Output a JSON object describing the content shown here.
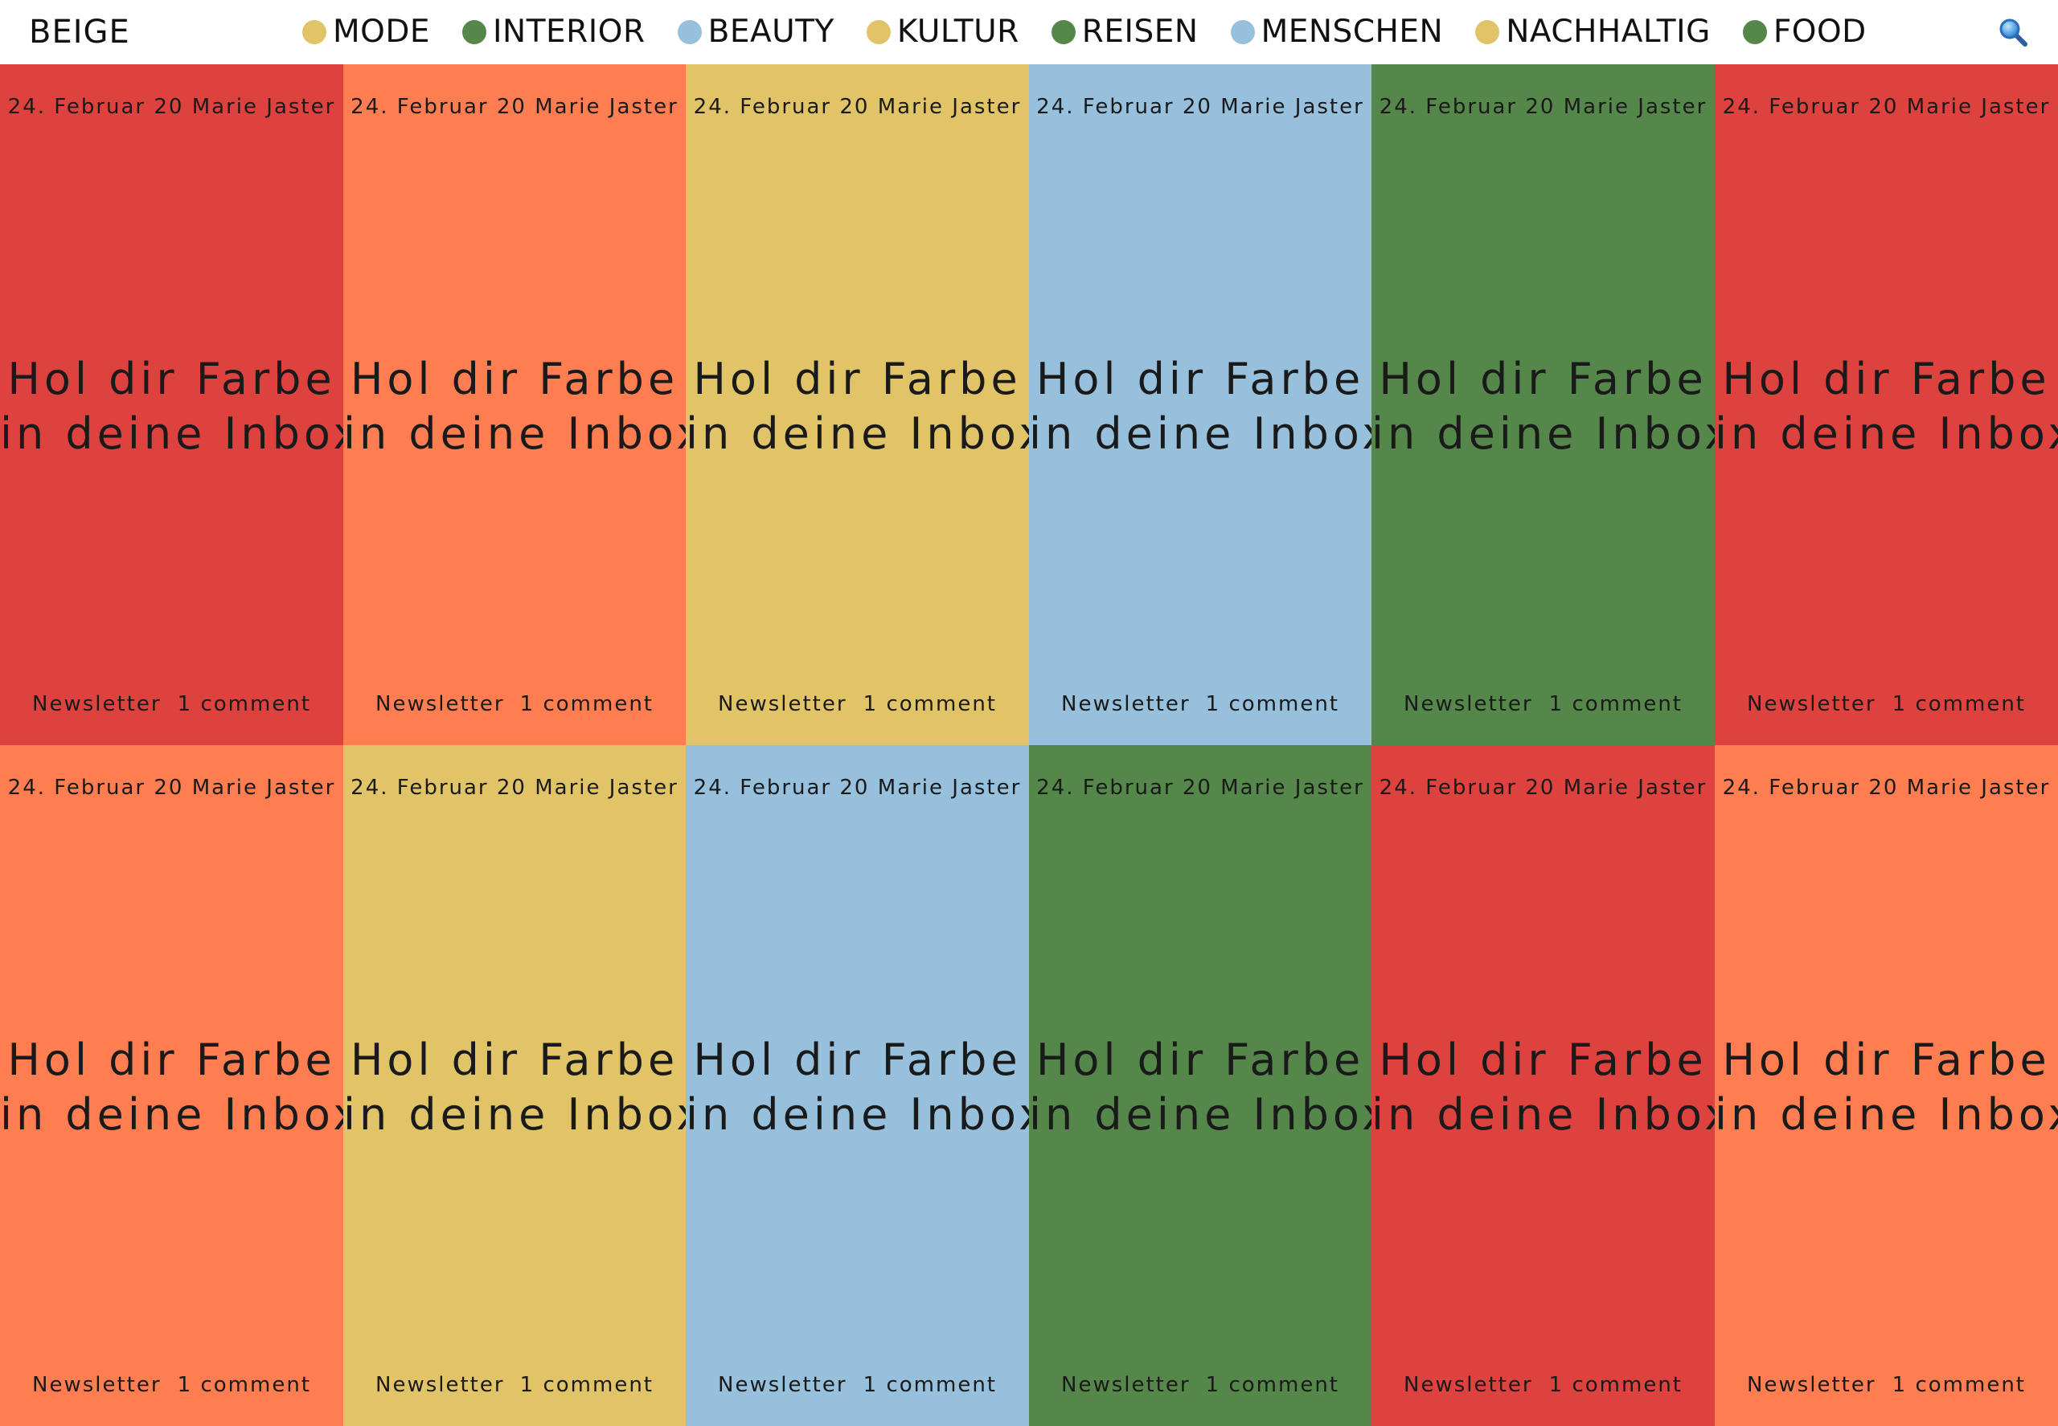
{
  "header": {
    "brand": "BEIGE",
    "nav": [
      {
        "label": "MODE",
        "color": "#e2c468"
      },
      {
        "label": "INTERIOR",
        "color": "#55864a"
      },
      {
        "label": "BEAUTY",
        "color": "#96c0db"
      },
      {
        "label": "KULTUR",
        "color": "#e2c468"
      },
      {
        "label": "REISEN",
        "color": "#55864a"
      },
      {
        "label": "MENSCHEN",
        "color": "#96c0db"
      },
      {
        "label": "NACHHALTIG",
        "color": "#e2c468"
      },
      {
        "label": "FOOD",
        "color": "#55864a"
      }
    ],
    "search_icon": "search-icon"
  },
  "cards": [
    {
      "color": "#dd423e",
      "date": "24. Februar 20",
      "author": "Marie Jaster",
      "title_line1": "Hol dir Farbe",
      "title_line2": "in deine Inbox",
      "category": "Newsletter",
      "comments": "1 comment"
    },
    {
      "color": "#ff7e51",
      "date": "24. Februar 20",
      "author": "Marie Jaster",
      "title_line1": "Hol dir Farbe",
      "title_line2": "in deine Inbox",
      "category": "Newsletter",
      "comments": "1 comment"
    },
    {
      "color": "#e2c468",
      "date": "24. Februar 20",
      "author": "Marie Jaster",
      "title_line1": "Hol dir Farbe",
      "title_line2": "in deine Inbox",
      "category": "Newsletter",
      "comments": "1 comment"
    },
    {
      "color": "#96c0dc",
      "date": "24. Februar 20",
      "author": "Marie Jaster",
      "title_line1": "Hol dir Farbe",
      "title_line2": "in deine Inbox",
      "category": "Newsletter",
      "comments": "1 comment"
    },
    {
      "color": "#55864a",
      "date": "24. Februar 20",
      "author": "Marie Jaster",
      "title_line1": "Hol dir Farbe",
      "title_line2": "in deine Inbox",
      "category": "Newsletter",
      "comments": "1 comment"
    },
    {
      "color": "#dd423e",
      "date": "24. Februar 20",
      "author": "Marie Jaster",
      "title_line1": "Hol dir Farbe",
      "title_line2": "in deine Inbox",
      "category": "Newsletter",
      "comments": "1 comment"
    },
    {
      "color": "#ff7e51",
      "date": "24. Februar 20",
      "author": "Marie Jaster",
      "title_line1": "Hol dir Farbe",
      "title_line2": "in deine Inbox",
      "category": "Newsletter",
      "comments": "1 comment"
    },
    {
      "color": "#e2c468",
      "date": "24. Februar 20",
      "author": "Marie Jaster",
      "title_line1": "Hol dir Farbe",
      "title_line2": "in deine Inbox",
      "category": "Newsletter",
      "comments": "1 comment"
    },
    {
      "color": "#96c0dc",
      "date": "24. Februar 20",
      "author": "Marie Jaster",
      "title_line1": "Hol dir Farbe",
      "title_line2": "in deine Inbox",
      "category": "Newsletter",
      "comments": "1 comment"
    },
    {
      "color": "#55864a",
      "date": "24. Februar 20",
      "author": "Marie Jaster",
      "title_line1": "Hol dir Farbe",
      "title_line2": "in deine Inbox",
      "category": "Newsletter",
      "comments": "1 comment"
    },
    {
      "color": "#dd423e",
      "date": "24. Februar 20",
      "author": "Marie Jaster",
      "title_line1": "Hol dir Farbe",
      "title_line2": "in deine Inbox",
      "category": "Newsletter",
      "comments": "1 comment"
    },
    {
      "color": "#ff7e51",
      "date": "24. Februar 20",
      "author": "Marie Jaster",
      "title_line1": "Hol dir Farbe",
      "title_line2": "in deine Inbox",
      "category": "Newsletter",
      "comments": "1 comment"
    }
  ]
}
